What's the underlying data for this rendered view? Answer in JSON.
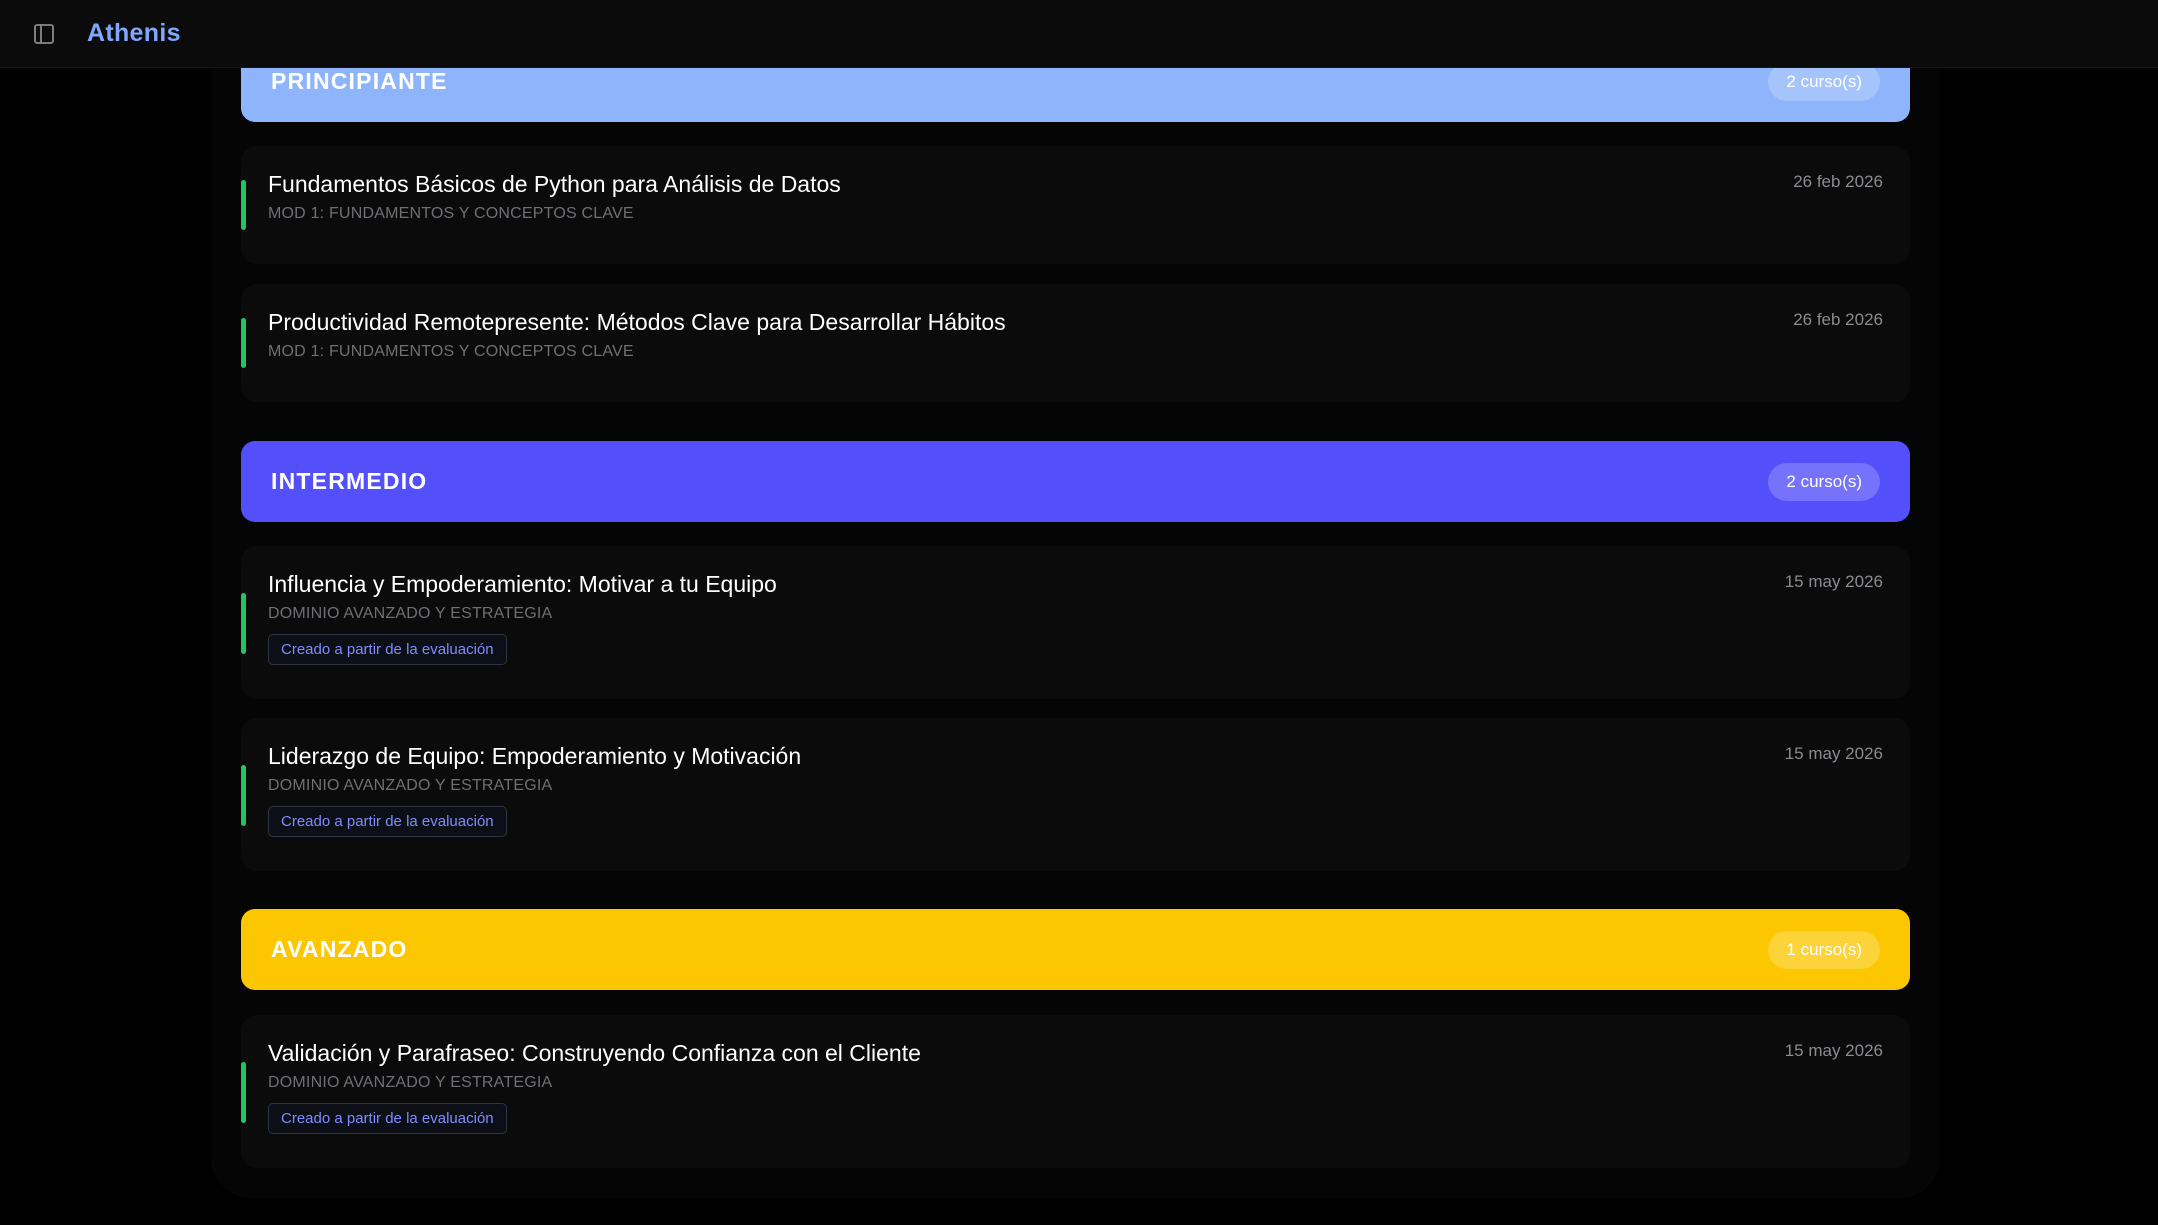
{
  "app": {
    "brand": "Athenis",
    "toggle_icon": "sidebar-toggle-icon"
  },
  "colors": {
    "principiante": "#8eb4fb",
    "intermedio": "#5350fb",
    "avanzado": "#fcc700",
    "accent": "#22c55e",
    "badge_text": "#7d8cff"
  },
  "levels": [
    {
      "title": "PRINCIPIANTE",
      "count": "2 curso(s)",
      "courses": [
        {
          "title": "Fundamentos Básicos de Python para Análisis de Datos",
          "module": "MOD 1: FUNDAMENTOS Y CONCEPTOS CLAVE",
          "date": "26 feb 2026"
        },
        {
          "title": "Productividad Remotepresente: Métodos Clave para Desarrollar Hábitos",
          "module": "MOD 1: FUNDAMENTOS Y CONCEPTOS CLAVE",
          "date": "26 feb 2026"
        }
      ]
    },
    {
      "title": "INTERMEDIO",
      "count": "2 curso(s)",
      "courses": [
        {
          "title": "Influencia y Empoderamiento: Motivar a tu Equipo",
          "module": "DOMINIO AVANZADO Y ESTRATEGIA",
          "date": "15 may 2026",
          "badge": "Creado a partir de la evaluación"
        },
        {
          "title": "Liderazgo de Equipo: Empoderamiento y Motivación",
          "module": "DOMINIO AVANZADO Y ESTRATEGIA",
          "date": "15 may 2026",
          "badge": "Creado a partir de la evaluación"
        }
      ]
    },
    {
      "title": "AVANZADO",
      "count": "1 curso(s)",
      "courses": [
        {
          "title": "Validación y Parafraseo: Construyendo Confianza con el Cliente",
          "module": "DOMINIO AVANZADO Y ESTRATEGIA",
          "date": "15 may 2026",
          "badge": "Creado a partir de la evaluación"
        }
      ]
    }
  ]
}
